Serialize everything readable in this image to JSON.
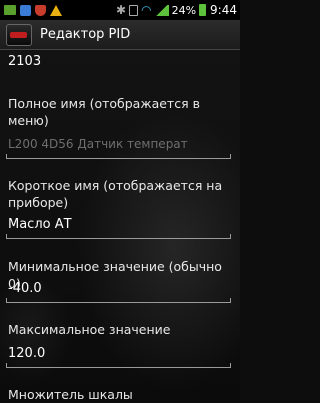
{
  "status_bar": {
    "left_icons": [
      "usb-icon",
      "app-notification-icon",
      "shield-icon",
      "warning-icon"
    ],
    "right_icons": [
      "bluetooth-icon",
      "vibrate-icon",
      "wifi-icon",
      "signal-icon",
      "battery-icon"
    ],
    "battery_percent": "24%",
    "time": "9:44"
  },
  "action_bar": {
    "title": "Редактор PID"
  },
  "form": {
    "top_value": "2103",
    "full_name": {
      "label": "Полное имя (отображается в меню)",
      "value": "L200 4D56 Датчик температ"
    },
    "short_name": {
      "label": "Короткое имя (отображается на приборе)",
      "value": "Масло АТ"
    },
    "min_value": {
      "label": "Минимальное значение (обычно 0)",
      "value": "-40.0"
    },
    "max_value": {
      "label": "Максимальное значение",
      "value": "120.0"
    },
    "scale_multiplier": {
      "label": "Множитель шкалы"
    }
  },
  "colors": {
    "background": "#0d0d0d",
    "action_bar": "#222222",
    "text": "#ffffff",
    "disabled_text": "#6e6e6e",
    "battery_green": "#5ec13c",
    "wifi_blue": "#3fb6e8"
  }
}
